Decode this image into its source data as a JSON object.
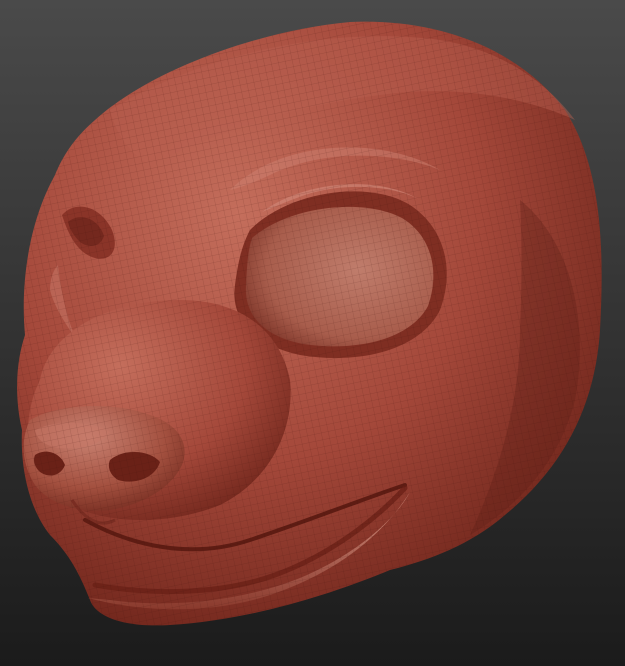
{
  "scene": {
    "subject": "sculpted-head-mesh",
    "background_top": "#4a4a4a",
    "background_bottom": "#1b1b1b",
    "clay_light": "#c46e5c",
    "clay_mid": "#a4483a",
    "clay_dark": "#6c2319",
    "wire_color": "#3e0f0a"
  }
}
